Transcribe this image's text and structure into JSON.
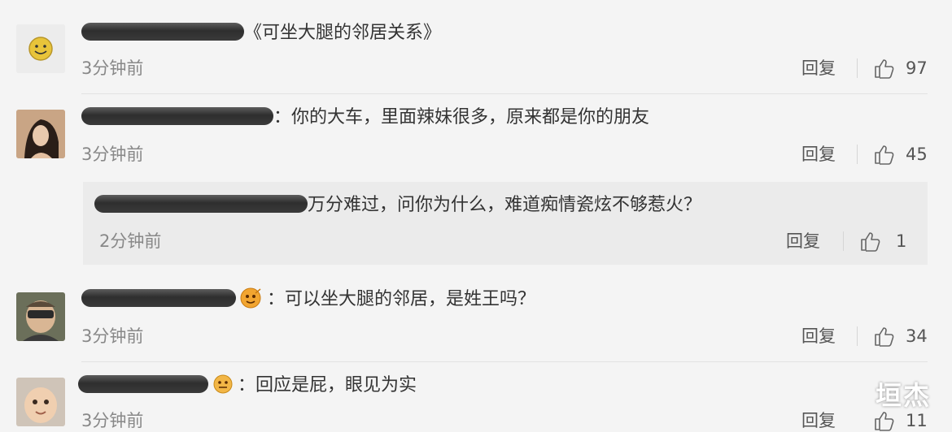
{
  "labels": {
    "reply": "回复"
  },
  "comments": [
    {
      "text": "《可坐大腿的邻居关系》",
      "time": "3分钟前",
      "likes": "97"
    },
    {
      "text": "：你的大车，里面辣妹很多，原来都是你的朋友",
      "time": "3分钟前",
      "likes": "45"
    },
    {
      "text": "万分难过，问你为什么，难道痴情瓷炫不够惹火？",
      "time": "2分钟前",
      "likes": "1"
    },
    {
      "text": "：可以坐大腿的邻居，是姓王吗？",
      "time": "3分钟前",
      "likes": "34"
    },
    {
      "text": "：回应是屁，眼见为实",
      "time": "3分钟前",
      "likes": "11"
    }
  ],
  "watermark": "垣杰",
  "colors": {
    "background": "#f4f4f4",
    "nested_background": "#ebebeb",
    "redaction": "#333333"
  }
}
